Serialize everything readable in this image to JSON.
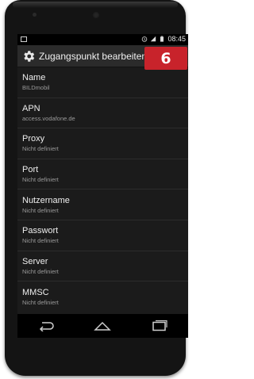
{
  "statusbar": {
    "time": "08:45"
  },
  "actionbar": {
    "title": "Zugangspunkt bearbeiten"
  },
  "badge": {
    "number": "6"
  },
  "settings": [
    {
      "title": "Name",
      "value": "BILDmobil"
    },
    {
      "title": "APN",
      "value": "access.vodafone.de"
    },
    {
      "title": "Proxy",
      "value": "Nicht definiert"
    },
    {
      "title": "Port",
      "value": "Nicht definiert"
    },
    {
      "title": "Nutzername",
      "value": "Nicht definiert"
    },
    {
      "title": "Passwort",
      "value": "Nicht definiert"
    },
    {
      "title": "Server",
      "value": "Nicht definiert"
    },
    {
      "title": "MMSC",
      "value": "Nicht definiert"
    }
  ],
  "icons": {
    "gear": "gear-icon",
    "back": "back-icon",
    "home": "home-icon",
    "recents": "recent-apps-icon"
  }
}
